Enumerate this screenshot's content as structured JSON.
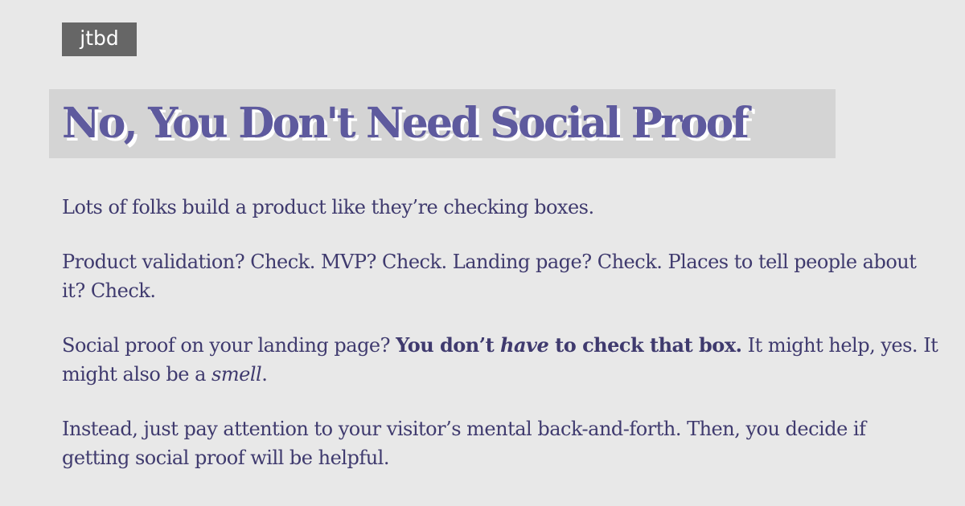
{
  "tag": {
    "label": "jtbd"
  },
  "article": {
    "title": "No, You Don't Need Social Proof",
    "paragraphs": {
      "p1": "Lots of folks build a product like they’re checking boxes.",
      "p2": "Product validation? Check. MVP? Check. Landing page? Check. Places to tell people about it? Check.",
      "p3": {
        "t1": "Social proof on your landing page? ",
        "b1": "You don’t ",
        "b2": "have",
        "b3": " to check that box.",
        "t2": " It might help, yes. It might also be a ",
        "em": "smell",
        "t3": "."
      },
      "p4": "Instead, just pay attention to your visitor’s mental back-and-forth. Then, you decide if getting social proof will be helpful."
    }
  },
  "colors": {
    "background": "#e8e8e8",
    "tag_background": "#666666",
    "title_background": "#d4d4d4",
    "title_text": "#5e5a9e",
    "title_shadow": "#ffffff",
    "body_text": "#3f3a6e"
  }
}
